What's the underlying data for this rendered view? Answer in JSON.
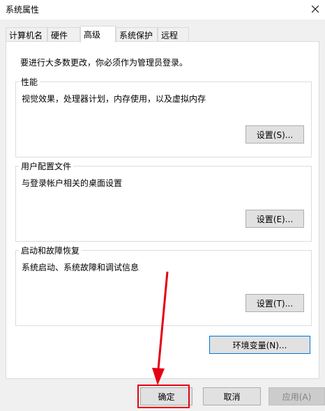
{
  "window": {
    "title": "系统属性"
  },
  "tabs": [
    {
      "label": "计算机名",
      "active": false
    },
    {
      "label": "硬件",
      "active": false
    },
    {
      "label": "高级",
      "active": true
    },
    {
      "label": "系统保护",
      "active": false
    },
    {
      "label": "远程",
      "active": false
    }
  ],
  "advanced": {
    "admin_note": "要进行大多数更改，你必须作为管理员登录。",
    "performance": {
      "title": "性能",
      "description": "视觉效果，处理器计划，内存使用，以及虚拟内存",
      "button": "设置(S)..."
    },
    "user_profiles": {
      "title": "用户配置文件",
      "description": "与登录帐户相关的桌面设置",
      "button": "设置(E)..."
    },
    "startup_recovery": {
      "title": "启动和故障恢复",
      "description": "系统启动、系统故障和调试信息",
      "button": "设置(T)..."
    },
    "env_button": "环境变量(N)..."
  },
  "footer": {
    "ok": "确定",
    "cancel": "取消",
    "apply": "应用(A)"
  },
  "colors": {
    "annotation": "#e50012",
    "focus_border": "#0078d7",
    "dialog_bg": "#f0f0f0"
  }
}
